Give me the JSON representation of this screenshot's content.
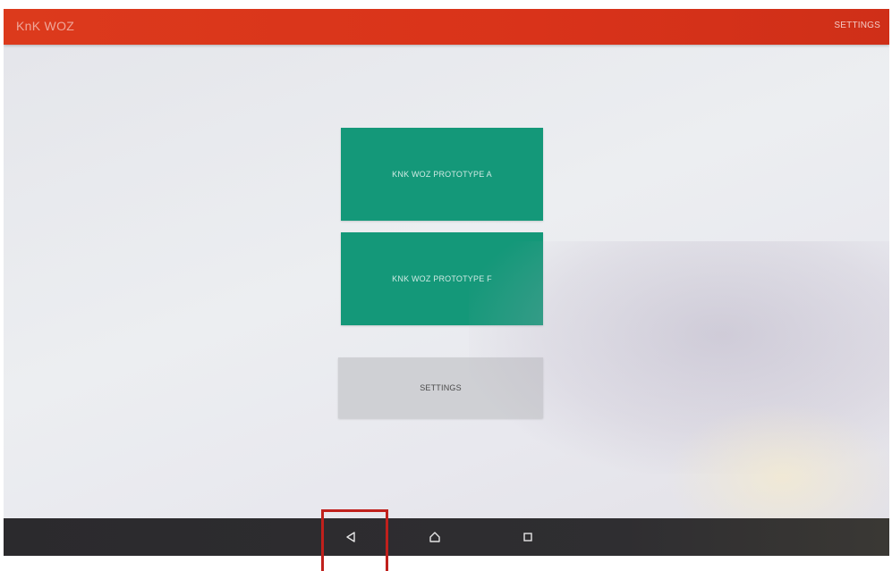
{
  "appbar": {
    "title": "KnK WOZ",
    "action_label": "SETTINGS",
    "color": "#dc3a1c"
  },
  "main": {
    "buttons": [
      {
        "label": "KNK WOZ PROTOTYPE A",
        "color": "#149879"
      },
      {
        "label": "KNK WOZ PROTOTYPE F",
        "color": "#149879"
      },
      {
        "label": "SETTINGS",
        "color": "#cfd0d4"
      }
    ]
  },
  "navbar": {
    "icons": [
      "back-icon",
      "home-icon",
      "recent-apps-icon"
    ]
  },
  "annotation": {
    "highlight_color": "#c0201c",
    "highlight_target": "back-icon"
  }
}
